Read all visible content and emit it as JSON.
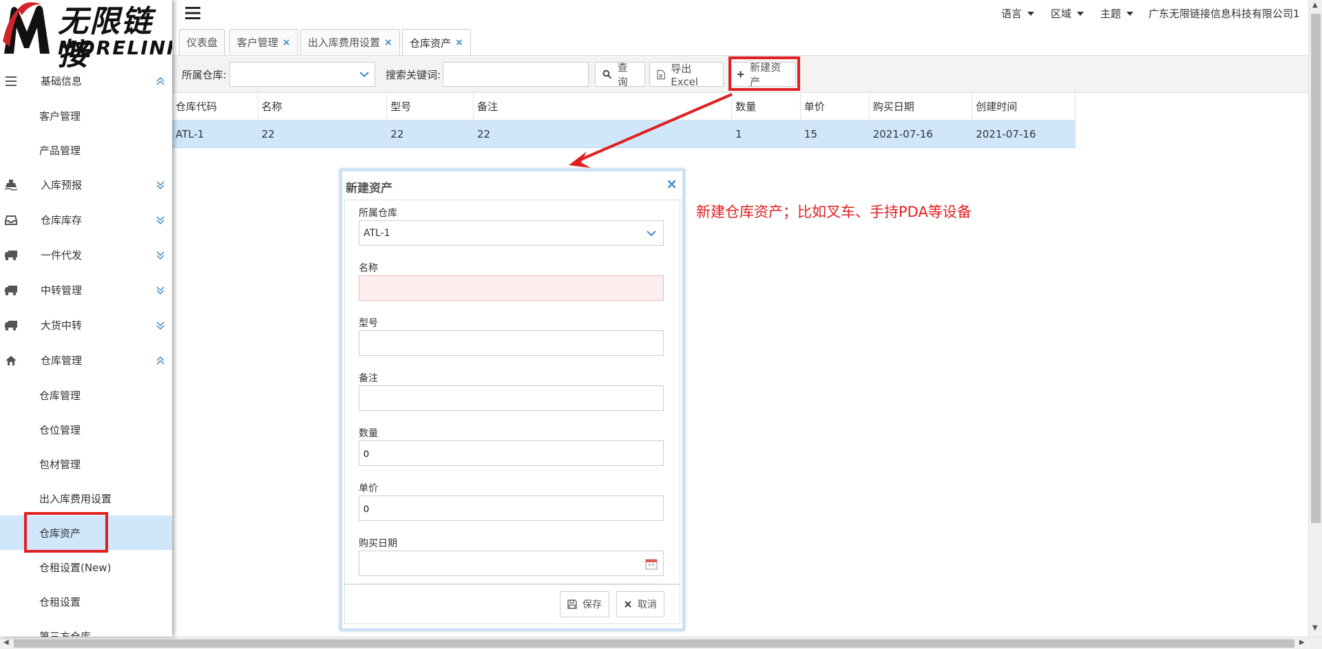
{
  "logo": {
    "cn": "无限链接",
    "en": "MORELINK"
  },
  "sidebar": {
    "groups": [
      {
        "label": "基础信息",
        "icon": "bars-icon",
        "expanded": true,
        "items": [
          "客户管理",
          "产品管理"
        ]
      },
      {
        "label": "入库预报",
        "icon": "ship-icon",
        "expanded": false
      },
      {
        "label": "仓库库存",
        "icon": "inbox-icon",
        "expanded": false
      },
      {
        "label": "一件代发",
        "icon": "truck-icon",
        "expanded": false
      },
      {
        "label": "中转管理",
        "icon": "truck-icon",
        "expanded": false
      },
      {
        "label": "大货中转",
        "icon": "truck-icon",
        "expanded": false
      },
      {
        "label": "仓库管理",
        "icon": "home-icon",
        "expanded": true,
        "items": [
          "仓库管理",
          "仓位管理",
          "包材管理",
          "出入库费用设置",
          "仓库资产",
          "仓租设置(New)",
          "仓租设置",
          "第三方仓库"
        ]
      }
    ],
    "active_item": "仓库资产"
  },
  "topbar": {
    "language": "语言",
    "region": "区域",
    "theme": "主题",
    "company": "广东无限链接信息科技有限公司1"
  },
  "tabs": [
    {
      "label": "仪表盘",
      "closable": false
    },
    {
      "label": "客户管理",
      "closable": true
    },
    {
      "label": "出入库费用设置",
      "closable": true
    },
    {
      "label": "仓库资产",
      "closable": true,
      "active": true
    }
  ],
  "toolbar": {
    "warehouse_label": "所属仓库:",
    "keyword_label": "搜索关键词:",
    "search_button": "查询",
    "export_button": "导出Excel",
    "new_button": "新建资产"
  },
  "grid": {
    "columns": [
      "仓库代码",
      "名称",
      "型号",
      "备注",
      "数量",
      "单价",
      "购买日期",
      "创建时间"
    ],
    "rows": [
      [
        "ATL-1",
        "22",
        "22",
        "22",
        "1",
        "15",
        "2021-07-16",
        "2021-07-16"
      ]
    ]
  },
  "dialog": {
    "title": "新建资产",
    "fields": {
      "warehouse": {
        "label": "所属仓库",
        "value": "ATL-1"
      },
      "name": {
        "label": "名称",
        "value": ""
      },
      "model": {
        "label": "型号",
        "value": ""
      },
      "remark": {
        "label": "备注",
        "value": ""
      },
      "quantity": {
        "label": "数量",
        "value": "0"
      },
      "price": {
        "label": "单价",
        "value": "0"
      },
      "purchase_date": {
        "label": "购买日期",
        "value": ""
      }
    },
    "save_button": "保存",
    "cancel_button": "取消"
  },
  "annotation": "新建仓库资产；比如叉车、手持PDA等设备",
  "colors": {
    "accent": "#3a87c8",
    "selected": "#cfe6fb",
    "annotation": "#e02020"
  }
}
